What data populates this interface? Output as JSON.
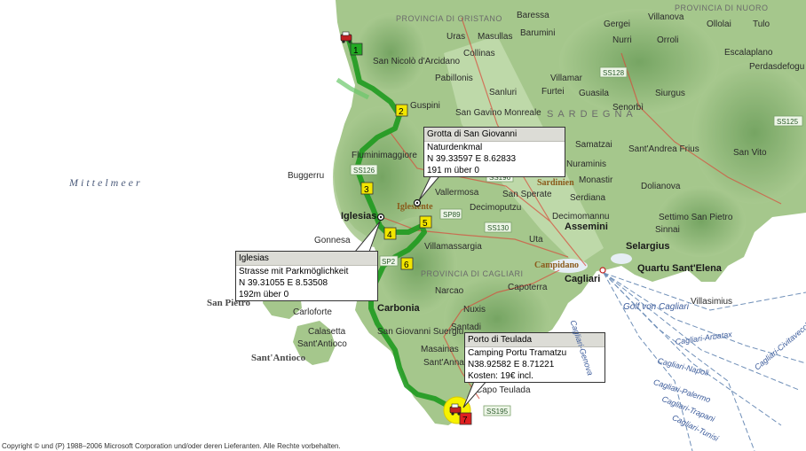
{
  "map": {
    "sea_label": "Mittelmeer",
    "gulf_label": "Golf von Cagliari",
    "region_labels": [
      "PROVINCIA DI ORISTANO",
      "PROVINCIA DI NUORO",
      "PROVINCIA DI CAGLIARI",
      "SARDEGNA"
    ],
    "islands": [
      "San Pietro",
      "Sant'Antioco"
    ],
    "poi_labels": [
      "Iglesiente",
      "Sardinien",
      "Campidano"
    ],
    "towns_bold": [
      "Iglesias",
      "Carbonia",
      "Assemini",
      "Selargius",
      "Cagliari",
      "Quartu Sant'Elena"
    ],
    "towns": [
      "Baressa",
      "Gergei",
      "Villanova",
      "Tulo",
      "Uras",
      "Masullas",
      "Barumini",
      "Ollolai",
      "Nurri",
      "Orroli",
      "San Nicolò d'Arcidano",
      "Collinas",
      "Escalaplano",
      "Pabillonis",
      "Villamar",
      "Perdasdefogu",
      "Sanluri",
      "Furtei",
      "Guspini",
      "Guasila",
      "Siurgus",
      "San Gavino Monreale",
      "Senorbì",
      "Fluminimaggiore",
      "Samatzai",
      "Sant'Andrea Frius",
      "Nuraminis",
      "Buggerru",
      "Monastir",
      "San Vito",
      "Vallermosa",
      "San Sperate",
      "Dolianova",
      "Serdiana",
      "Decimoputzu",
      "Gonnesa",
      "Decimomannu",
      "Settimo San Pietro",
      "Villamassargia",
      "Uta",
      "Sinnai",
      "Capoterra",
      "Narcao",
      "Carloforte",
      "Nuxis",
      "Calasetta",
      "San Giovanni Suergiu",
      "Santadi",
      "Sant'Antioco",
      "Masainas",
      "Sant'Anna Arresi",
      "Capo Teulada",
      "Villasimius"
    ],
    "road_shields": [
      "SS128",
      "SS125",
      "SS126",
      "SS196",
      "SP89",
      "SS130",
      "SP2",
      "SS195"
    ],
    "ferry_routes": [
      "Cagliari-Genova",
      "Cagliari-Civitavecchia",
      "Cagliari-Arbatax",
      "Cagliari-Napoli",
      "Cagliari-Palermo",
      "Cagliari-Trapani",
      "Cagliari-Tunisi"
    ],
    "colors": {
      "sea": "#ffffff",
      "land": "#9fc487",
      "mountain": "#7fae6b",
      "route": "#1f9a1f",
      "start_marker": "#22aa22",
      "waypoint_marker": "#f2e600",
      "end_marker": "#e02020",
      "end_highlight": "#f7f200"
    }
  },
  "route": {
    "waypoints": [
      "1",
      "2",
      "3",
      "4",
      "5",
      "6",
      "7"
    ],
    "icons": [
      "car-icon",
      "tent-icon"
    ]
  },
  "callouts": [
    {
      "title": "Grotta di San Giovanni",
      "lines": [
        "Naturdenkmal",
        "N 39.33597 E 8.62833",
        "191 m über 0"
      ]
    },
    {
      "title": "Iglesias",
      "lines": [
        "Strasse mit Parkmöglichkeit",
        "N 39.31055 E 8.53508",
        "192m über 0"
      ]
    },
    {
      "title": "Porto di Teulada",
      "lines": [
        "Camping Portu Tramatzu",
        "N38.92582 E 8.71221",
        "Kosten: 19€ incl."
      ]
    }
  ],
  "copyright": "Copyright © und (P) 1988–2006 Microsoft Corporation und/oder deren Lieferanten. Alle Rechte vorbehalten."
}
